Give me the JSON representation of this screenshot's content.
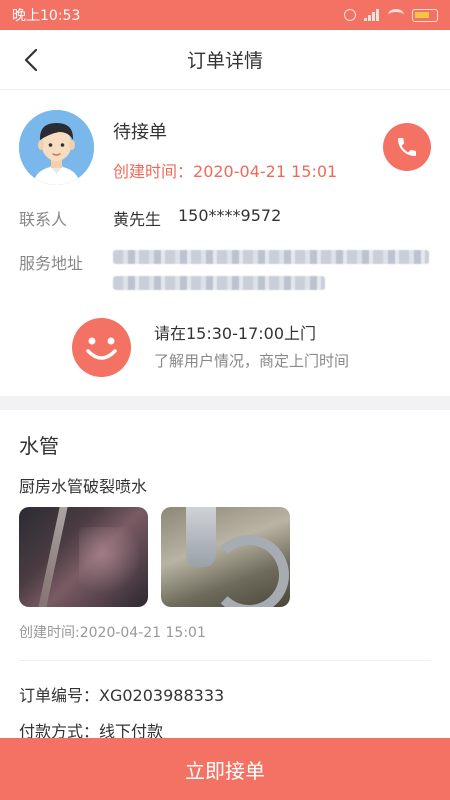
{
  "status_bar": {
    "time": "晚上10:53",
    "icons": [
      "alarm-icon",
      "signal-icon",
      "wifi-icon",
      "battery-icon"
    ]
  },
  "header": {
    "title": "订单详情",
    "back_icon": "chevron-left-icon"
  },
  "order_status": {
    "status": "待接单",
    "created_label": "创建时间：",
    "created_time": "2020-04-21 15:01",
    "accent_color": "#f06a5b"
  },
  "contact": {
    "label": "联系人",
    "name": "黄先生",
    "phone": "150****9572"
  },
  "address": {
    "label": "服务地址"
  },
  "visit": {
    "time_text": "请在15:30-17:00上门",
    "hint": "了解用户情况，商定上门时间"
  },
  "service": {
    "category": "水管",
    "description": "厨房水管破裂喷水",
    "created_text": "创建时间:2020-04-21 15:01"
  },
  "order": {
    "number_label": "订单编号：",
    "number": "XG0203988333",
    "payment_label": "付款方式：",
    "payment": "线下付款"
  },
  "action": {
    "accept_label": "立即接单",
    "button_color": "#f47264"
  }
}
